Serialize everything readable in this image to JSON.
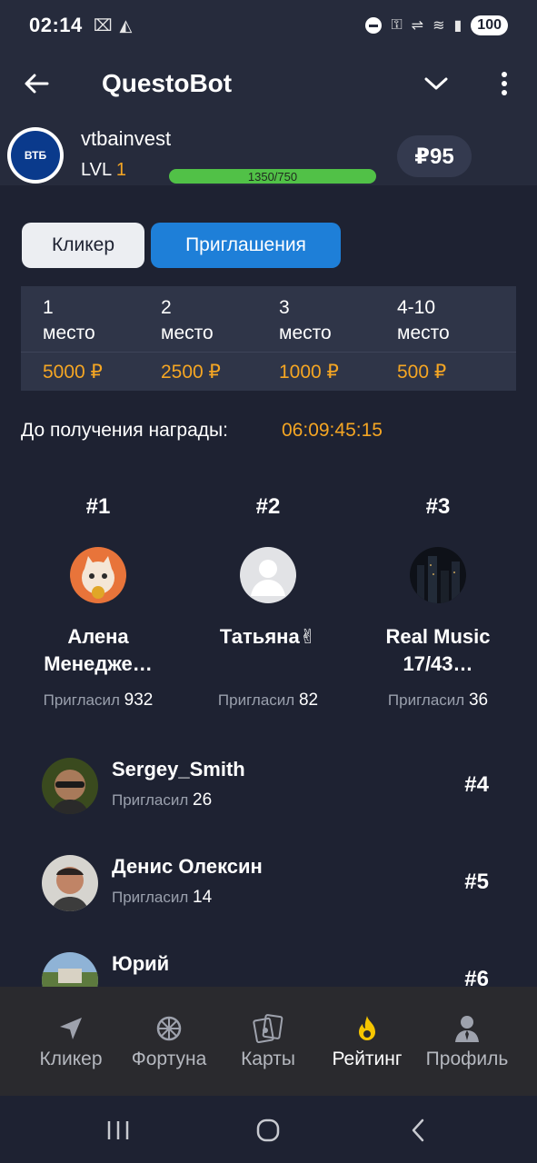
{
  "status": {
    "time": "02:14",
    "battery": "100",
    "left_icons": [
      "⌧",
      "◭"
    ],
    "right_icons": [
      "⚿",
      "⇌",
      "≋",
      "▮"
    ]
  },
  "appbar": {
    "title": "QuestoBot"
  },
  "user": {
    "logo_text": "ВТБ",
    "name": "vtbainvest",
    "lvl_label": "LVL",
    "lvl": "1",
    "xp": "1350/750",
    "balance": "₽95"
  },
  "tabs": [
    {
      "label": "Кликер"
    },
    {
      "label": "Приглашения"
    }
  ],
  "prizes": [
    {
      "place": "1",
      "place_word": "место",
      "amount": "5000 ₽"
    },
    {
      "place": "2",
      "place_word": "место",
      "amount": "2500 ₽"
    },
    {
      "place": "3",
      "place_word": "место",
      "amount": "1000 ₽"
    },
    {
      "place": "4-10",
      "place_word": "место",
      "amount": "500 ₽"
    }
  ],
  "countdown": {
    "label": "До получения награды:",
    "value": "06:09:45:15"
  },
  "podium": [
    {
      "rank": "#1",
      "name_line1": "Алена",
      "name_line2": "Менедже…",
      "stat_label": "Пригласил",
      "count": "932"
    },
    {
      "rank": "#2",
      "name_line1": "Татьяна✌",
      "name_line2": "",
      "stat_label": "Пригласил",
      "count": "82"
    },
    {
      "rank": "#3",
      "name_line1": "Real Music",
      "name_line2": "17/43…",
      "stat_label": "Пригласил",
      "count": "36"
    }
  ],
  "list": [
    {
      "name": "Sergey_Smith",
      "stat_label": "Пригласил",
      "count": "26",
      "rank": "#4"
    },
    {
      "name": "Денис Олексин",
      "stat_label": "Пригласил",
      "count": "14",
      "rank": "#5"
    },
    {
      "name": "Юрий",
      "stat_label": "",
      "count": "",
      "rank": "#6"
    }
  ],
  "nav": [
    {
      "label": "Кликер",
      "icon": "navigation-arrow-icon"
    },
    {
      "label": "Фортуна",
      "icon": "wheel-icon"
    },
    {
      "label": "Карты",
      "icon": "cards-icon"
    },
    {
      "label": "Рейтинг",
      "icon": "flame-icon"
    },
    {
      "label": "Профиль",
      "icon": "person-icon"
    }
  ],
  "colors": {
    "accent": "#f5a623",
    "tab_active": "#1e7fd8",
    "xp_green": "#51c147",
    "bg": "#1e2232",
    "panel": "#262b3c"
  }
}
